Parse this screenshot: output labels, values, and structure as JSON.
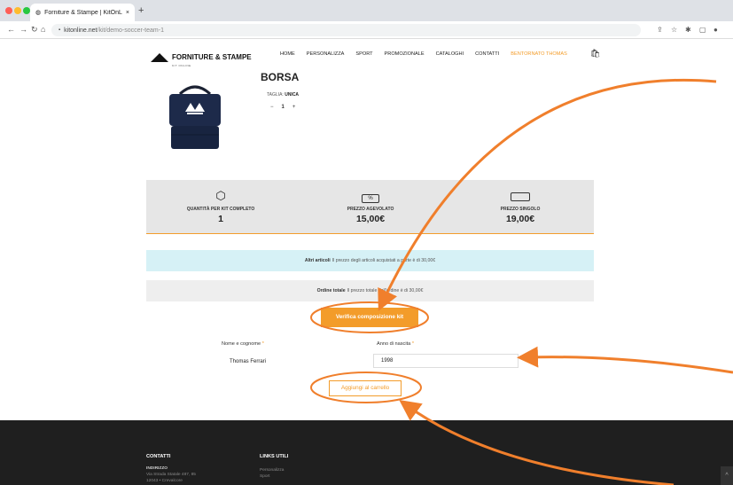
{
  "browser": {
    "tab_title": "Forniture & Stampe | KitOnLine",
    "tab_close": "×",
    "new_tab": "+",
    "url_domain": "kitonline.net",
    "url_path": "/kit/demo-soccer-team-1",
    "lock_glyph": "🔒"
  },
  "header": {
    "logo_text": "FORNITURE & STAMPE",
    "logo_sub": "KIT ONLINE",
    "nav": [
      "HOME",
      "PERSONALIZZA",
      "SPORT",
      "PROMOZIONALE",
      "CATALOGHI",
      "CONTATTI"
    ],
    "user_greeting": "BENTORNATO THOMAS"
  },
  "product": {
    "title": "BORSA",
    "size_label": "TAGLIA:",
    "size_value": "UNICA",
    "qty_minus": "−",
    "qty_value": "1",
    "qty_plus": "+"
  },
  "stats": [
    {
      "label": "QUANTITÀ PER KIT COMPLETO",
      "value": "1"
    },
    {
      "label": "PREZZO AGEVOLATO",
      "value": "15,00€"
    },
    {
      "label": "PREZZO SINGOLO",
      "value": "19,00€"
    }
  ],
  "stat_icon_percent": "%",
  "notices": {
    "other_bold": "Altri articoli",
    "other_text": "Il prezzo degli articoli acquistati a parte è di 30,00€",
    "total_bold": "Ordine totale",
    "total_text": "Il prezzo totale dell'ordine è di 30,00€"
  },
  "verify_button": "Verifica composizione kit",
  "form": {
    "name_label": "Nome e cognome",
    "name_value": "Thomas Ferrari",
    "birth_label": "Anno di nascita",
    "birth_value": "1998",
    "required_mark": "*"
  },
  "add_to_cart_button": "Aggiungi al carrello",
  "footer": {
    "contacts_title": "CONTATTI",
    "address_label": "INDIRIZZO",
    "address_line1": "Via Strada Statale 487, 85",
    "address_line2": "12043 • Crevalcore",
    "links_title": "LINKS UTILI",
    "links": [
      "Personalizza",
      "Sport"
    ],
    "scroll_top": "^"
  },
  "colors": {
    "accent": "#f39c2a",
    "annotation": "#f07f2c",
    "blue_notice": "#d6f1f6",
    "footer_bg": "#1f1f1f"
  }
}
